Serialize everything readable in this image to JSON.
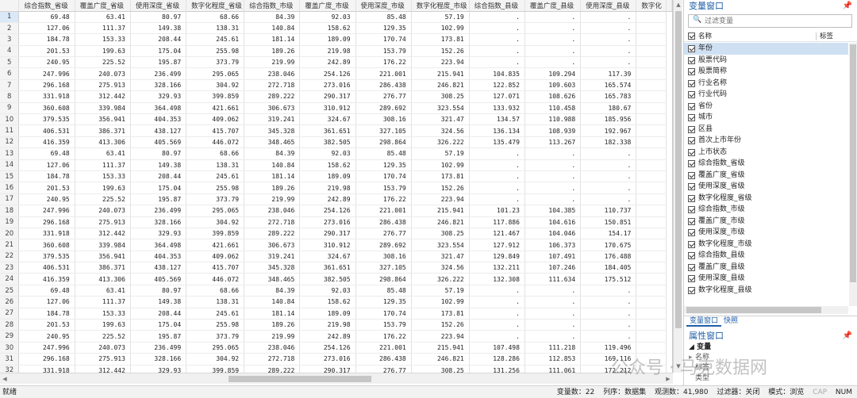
{
  "grid": {
    "columns": [
      "综合指数_省级",
      "覆盖广度_省级",
      "使用深度_省级",
      "数字化程度_省级",
      "综合指数_市级",
      "覆盖广度_市级",
      "使用深度_市级",
      "数字化程度_市级",
      "综合指数_县级",
      "覆盖广度_县级",
      "使用深度_县级",
      "数字化"
    ],
    "rows": [
      [
        "1",
        "69.48",
        "63.41",
        "80.97",
        "68.66",
        "84.39",
        "92.03",
        "85.48",
        "57.19",
        ".",
        ".",
        "."
      ],
      [
        "2",
        "127.06",
        "111.37",
        "149.38",
        "138.31",
        "140.84",
        "158.62",
        "129.35",
        "102.99",
        ".",
        ".",
        "."
      ],
      [
        "3",
        "184.78",
        "153.33",
        "208.44",
        "245.61",
        "181.14",
        "189.09",
        "170.74",
        "173.81",
        ".",
        ".",
        "."
      ],
      [
        "4",
        "201.53",
        "199.63",
        "175.04",
        "255.98",
        "189.26",
        "219.98",
        "153.79",
        "152.26",
        ".",
        ".",
        "."
      ],
      [
        "5",
        "240.95",
        "225.52",
        "195.87",
        "373.79",
        "219.99",
        "242.89",
        "176.22",
        "223.94",
        ".",
        ".",
        "."
      ],
      [
        "6",
        "247.996",
        "240.073",
        "236.499",
        "295.065",
        "238.046",
        "254.126",
        "221.001",
        "215.941",
        "104.835",
        "109.294",
        "117.39"
      ],
      [
        "7",
        "296.168",
        "275.913",
        "328.166",
        "304.92",
        "272.718",
        "273.016",
        "286.438",
        "246.821",
        "122.852",
        "109.603",
        "165.574"
      ],
      [
        "8",
        "331.918",
        "312.442",
        "329.93",
        "399.859",
        "289.222",
        "290.317",
        "276.77",
        "308.25",
        "127.071",
        "108.626",
        "165.783"
      ],
      [
        "9",
        "360.608",
        "339.984",
        "364.498",
        "421.661",
        "306.673",
        "310.912",
        "289.692",
        "323.554",
        "133.932",
        "110.458",
        "180.67"
      ],
      [
        "10",
        "379.535",
        "356.941",
        "404.353",
        "409.062",
        "319.241",
        "324.67",
        "308.16",
        "321.47",
        "134.57",
        "110.988",
        "185.956"
      ],
      [
        "11",
        "406.531",
        "386.371",
        "438.127",
        "415.707",
        "345.328",
        "361.651",
        "327.105",
        "324.56",
        "136.134",
        "108.939",
        "192.967"
      ],
      [
        "12",
        "416.359",
        "413.306",
        "405.569",
        "446.072",
        "348.465",
        "382.505",
        "298.864",
        "326.222",
        "135.479",
        "113.267",
        "182.338"
      ],
      [
        "13",
        "69.48",
        "63.41",
        "80.97",
        "68.66",
        "84.39",
        "92.03",
        "85.48",
        "57.19",
        ".",
        ".",
        "."
      ],
      [
        "14",
        "127.06",
        "111.37",
        "149.38",
        "138.31",
        "140.84",
        "158.62",
        "129.35",
        "102.99",
        ".",
        ".",
        "."
      ],
      [
        "15",
        "184.78",
        "153.33",
        "208.44",
        "245.61",
        "181.14",
        "189.09",
        "170.74",
        "173.81",
        ".",
        ".",
        "."
      ],
      [
        "16",
        "201.53",
        "199.63",
        "175.04",
        "255.98",
        "189.26",
        "219.98",
        "153.79",
        "152.26",
        ".",
        ".",
        "."
      ],
      [
        "17",
        "240.95",
        "225.52",
        "195.87",
        "373.79",
        "219.99",
        "242.89",
        "176.22",
        "223.94",
        ".",
        ".",
        "."
      ],
      [
        "18",
        "247.996",
        "240.073",
        "236.499",
        "295.065",
        "238.046",
        "254.126",
        "221.001",
        "215.941",
        "101.23",
        "104.385",
        "110.737"
      ],
      [
        "19",
        "296.168",
        "275.913",
        "328.166",
        "304.92",
        "272.718",
        "273.016",
        "286.438",
        "246.821",
        "117.886",
        "104.616",
        "150.851"
      ],
      [
        "20",
        "331.918",
        "312.442",
        "329.93",
        "399.859",
        "289.222",
        "290.317",
        "276.77",
        "308.25",
        "121.467",
        "104.046",
        "154.17"
      ],
      [
        "21",
        "360.608",
        "339.984",
        "364.498",
        "421.661",
        "306.673",
        "310.912",
        "289.692",
        "323.554",
        "127.912",
        "106.373",
        "170.675"
      ],
      [
        "22",
        "379.535",
        "356.941",
        "404.353",
        "409.062",
        "319.241",
        "324.67",
        "308.16",
        "321.47",
        "129.849",
        "107.491",
        "176.488"
      ],
      [
        "23",
        "406.531",
        "386.371",
        "438.127",
        "415.707",
        "345.328",
        "361.651",
        "327.105",
        "324.56",
        "132.211",
        "107.246",
        "184.405"
      ],
      [
        "24",
        "416.359",
        "413.306",
        "405.569",
        "446.072",
        "348.465",
        "382.505",
        "298.864",
        "326.222",
        "132.308",
        "111.634",
        "175.512"
      ],
      [
        "25",
        "69.48",
        "63.41",
        "80.97",
        "68.66",
        "84.39",
        "92.03",
        "85.48",
        "57.19",
        ".",
        ".",
        "."
      ],
      [
        "26",
        "127.06",
        "111.37",
        "149.38",
        "138.31",
        "140.84",
        "158.62",
        "129.35",
        "102.99",
        ".",
        ".",
        "."
      ],
      [
        "27",
        "184.78",
        "153.33",
        "208.44",
        "245.61",
        "181.14",
        "189.09",
        "170.74",
        "173.81",
        ".",
        ".",
        "."
      ],
      [
        "28",
        "201.53",
        "199.63",
        "175.04",
        "255.98",
        "189.26",
        "219.98",
        "153.79",
        "152.26",
        ".",
        ".",
        "."
      ],
      [
        "29",
        "240.95",
        "225.52",
        "195.87",
        "373.79",
        "219.99",
        "242.89",
        "176.22",
        "223.94",
        ".",
        ".",
        "."
      ],
      [
        "30",
        "247.996",
        "240.073",
        "236.499",
        "295.065",
        "238.046",
        "254.126",
        "221.001",
        "215.941",
        "107.498",
        "111.218",
        "119.496"
      ],
      [
        "31",
        "296.168",
        "275.913",
        "328.166",
        "304.92",
        "272.718",
        "273.016",
        "286.438",
        "246.821",
        "128.286",
        "112.853",
        "169.116"
      ],
      [
        "32",
        "331.918",
        "312.442",
        "329.93",
        "399.859",
        "289.222",
        "290.317",
        "276.77",
        "308.25",
        "131.256",
        "111.061",
        "172.212"
      ]
    ]
  },
  "variables_panel": {
    "title": "变量窗口",
    "filter_placeholder": "过滤变量",
    "header_name": "名称",
    "header_label": "标签",
    "items": [
      "年份",
      "股票代码",
      "股票简称",
      "行业名称",
      "行业代码",
      "省份",
      "城市",
      "区县",
      "首次上市年份",
      "上市状态",
      "综合指数_省级",
      "覆盖广度_省级",
      "使用深度_省级",
      "数字化程度_省级",
      "综合指数_市级",
      "覆盖广度_市级",
      "使用深度_市级",
      "数字化程度_市级",
      "综合指数_县级",
      "覆盖广度_县级",
      "使用深度_县级",
      "数字化程度_县级"
    ],
    "selected_index": 0,
    "tabs": [
      "变量窗口",
      "快照"
    ]
  },
  "properties_panel": {
    "title": "属性窗口",
    "section": "变量",
    "rows": [
      "名称",
      "标签",
      "类型"
    ]
  },
  "statusbar": {
    "left": "就绪",
    "var_count": "变量数：22",
    "sort": "列序：数据集",
    "obs": "观测数：41,980",
    "filter": "过滤器：关闭",
    "mode": "模式：浏览",
    "cap": "CAP",
    "num": "NUM"
  },
  "watermark": "公众号 · 马克数据网"
}
